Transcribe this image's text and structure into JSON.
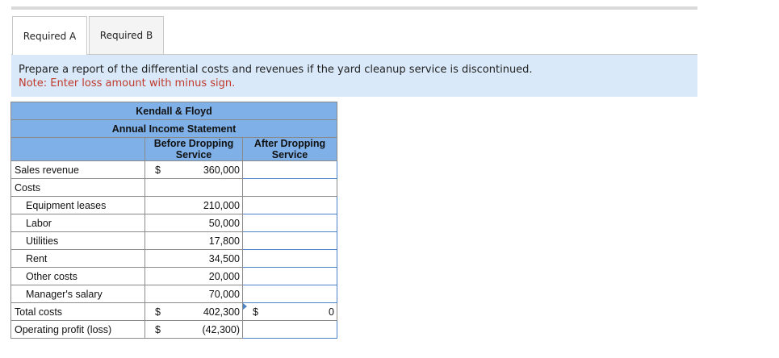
{
  "tabs": [
    {
      "label": "Required A",
      "active": true
    },
    {
      "label": "Required B",
      "active": false
    }
  ],
  "instructions": {
    "text": "Prepare a report of the differential costs and revenues if the yard cleanup service is discontinued.",
    "note": "Note: Enter loss amount with minus sign."
  },
  "statement": {
    "company": "Kendall & Floyd",
    "title": "Annual Income Statement",
    "col_before": "Before Dropping Service",
    "col_after": "After Dropping Service",
    "rows": [
      {
        "label": "Sales revenue",
        "indent": false,
        "dollar_before": "$",
        "before": "360,000",
        "dollar_after": "",
        "after": ""
      },
      {
        "label": "Costs",
        "indent": false,
        "dollar_before": "",
        "before": "",
        "dollar_after": "",
        "after": ""
      },
      {
        "label": "Equipment leases",
        "indent": true,
        "dollar_before": "",
        "before": "210,000",
        "dollar_after": "",
        "after": ""
      },
      {
        "label": "Labor",
        "indent": true,
        "dollar_before": "",
        "before": "50,000",
        "dollar_after": "",
        "after": ""
      },
      {
        "label": "Utilities",
        "indent": true,
        "dollar_before": "",
        "before": "17,800",
        "dollar_after": "",
        "after": ""
      },
      {
        "label": "Rent",
        "indent": true,
        "dollar_before": "",
        "before": "34,500",
        "dollar_after": "",
        "after": ""
      },
      {
        "label": "Other costs",
        "indent": true,
        "dollar_before": "",
        "before": "20,000",
        "dollar_after": "",
        "after": ""
      },
      {
        "label": "Manager's salary",
        "indent": true,
        "dollar_before": "",
        "before": "70,000",
        "dollar_after": "",
        "after": ""
      },
      {
        "label": "Total costs",
        "indent": false,
        "dollar_before": "$",
        "before": "402,300",
        "dollar_after": "$",
        "after": "0"
      },
      {
        "label": "Operating profit (loss)",
        "indent": false,
        "dollar_before": "$",
        "before": "(42,300)",
        "dollar_after": "",
        "after": ""
      }
    ]
  },
  "colors": {
    "header_bg": "#7fb1e8",
    "instructions_bg": "#d9e9f9",
    "note_text": "#c0392b",
    "input_border": "#4b82c8"
  }
}
